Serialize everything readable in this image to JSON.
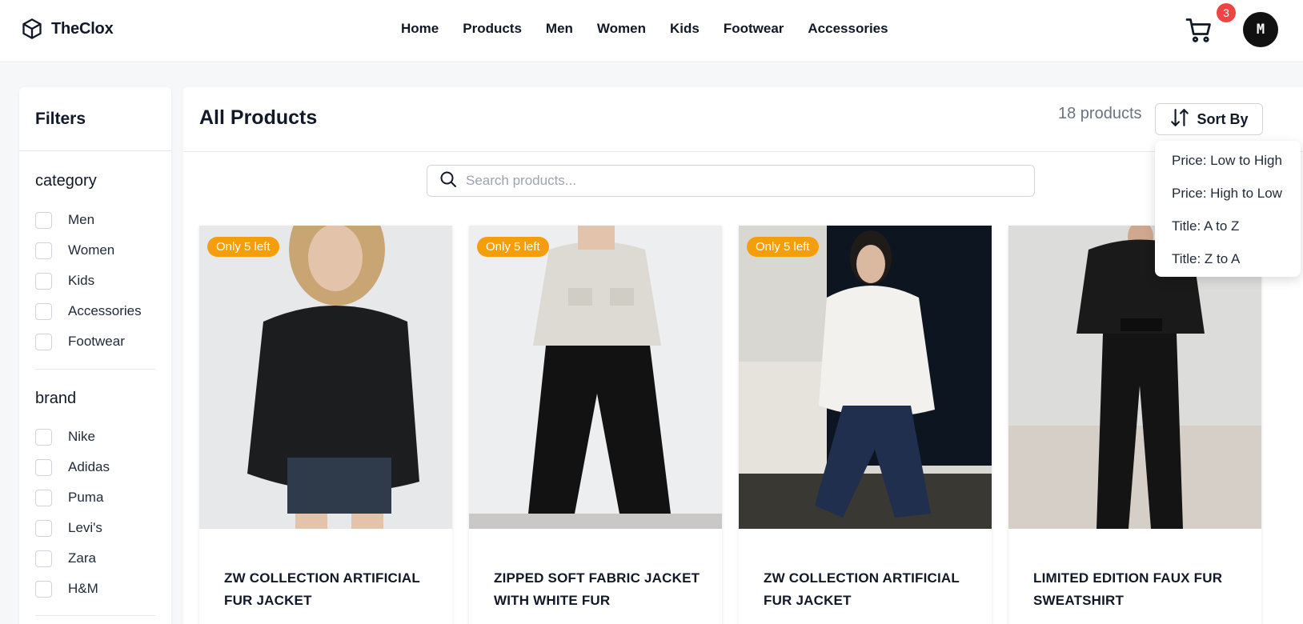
{
  "header": {
    "brand_name": "TheClox",
    "nav": [
      "Home",
      "Products",
      "Men",
      "Women",
      "Kids",
      "Footwear",
      "Accessories"
    ],
    "cart_count": "3",
    "avatar_initial": "M"
  },
  "sidebar": {
    "title": "Filters",
    "groups": [
      {
        "title": "category",
        "options": [
          "Men",
          "Women",
          "Kids",
          "Accessories",
          "Footwear"
        ]
      },
      {
        "title": "brand",
        "options": [
          "Nike",
          "Adidas",
          "Puma",
          "Levi's",
          "Zara",
          "H&M"
        ]
      }
    ]
  },
  "main": {
    "title": "All Products",
    "product_count": "18 products",
    "sort_label": "Sort By",
    "search_placeholder": "Search products..."
  },
  "sort_menu": {
    "options": [
      "Price: Low to High",
      "Price: High to Low",
      "Title: A to Z",
      "Title: Z to A"
    ]
  },
  "products": [
    {
      "badge": "Only 5 left",
      "title": "ZW COLLECTION ARTIFICIAL FUR JACKET"
    },
    {
      "badge": "Only 5 left",
      "title": "ZIPPED SOFT FABRIC JACKET WITH WHITE FUR"
    },
    {
      "badge": "Only 5 left",
      "title": "ZW COLLECTION ARTIFICIAL FUR JACKET"
    },
    {
      "badge": "",
      "title": "LIMITED EDITION FAUX FUR SWEATSHIRT"
    }
  ],
  "colors": {
    "accent_badge": "#f59e0b",
    "cart_badge": "#ef4444",
    "avatar_bg": "#111111"
  },
  "icons": {
    "brand": "cube-icon",
    "cart": "cart-icon",
    "sort": "sort-arrows-icon",
    "search": "search-icon"
  }
}
